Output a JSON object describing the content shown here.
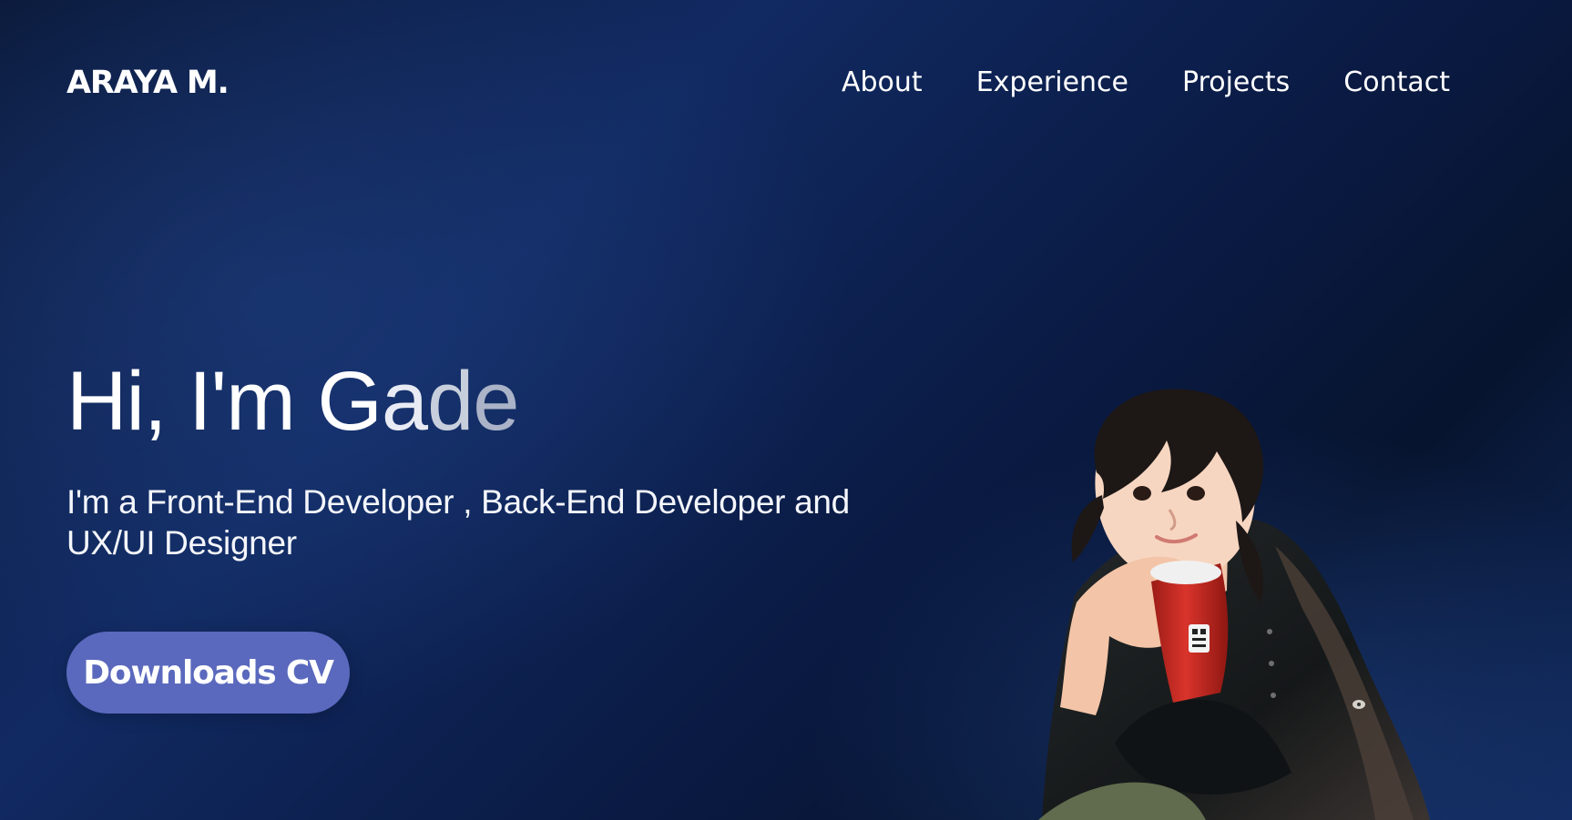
{
  "header": {
    "logo": "ARAYA M.",
    "nav": [
      "About",
      "Experience",
      "Projects",
      "Contact"
    ]
  },
  "hero": {
    "greeting_prefix": "Hi, I'm G",
    "greeting_a": "a",
    "greeting_d": "d",
    "greeting_e": "e",
    "subtitle": "I'm a Front-End Developer , Back-End Developer and UX/UI Designer",
    "cta_label": "Downloads CV"
  },
  "colors": {
    "background": "#0b1736",
    "accent": "#5a69bd",
    "text": "#ffffff"
  },
  "image": {
    "name": "character-illustration",
    "icon": "anime-character"
  }
}
